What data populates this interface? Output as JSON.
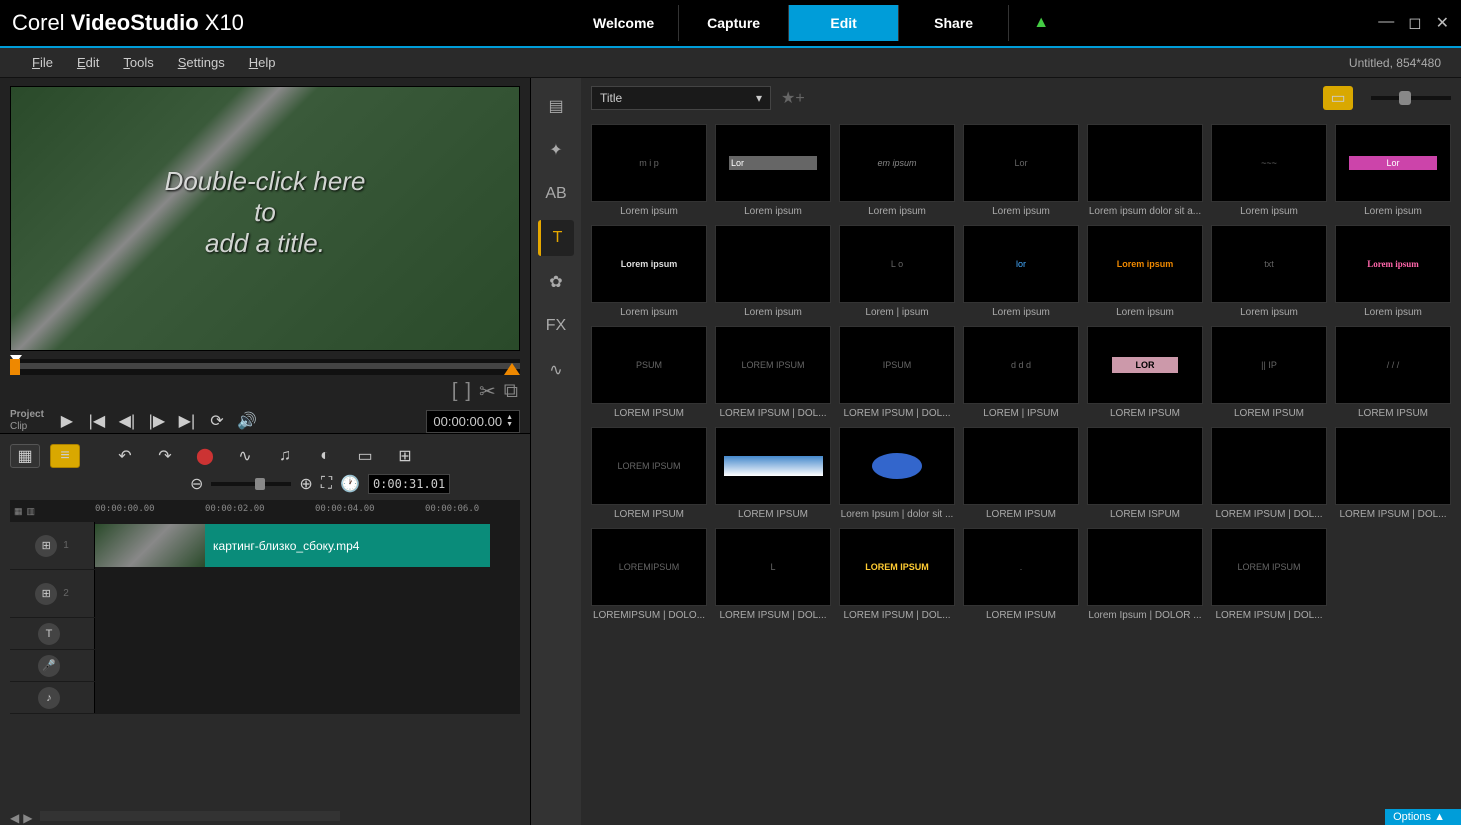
{
  "app": {
    "name_prefix": "Corel",
    "name_main": "VideoStudio",
    "name_suffix": "X10"
  },
  "main_tabs": [
    "Welcome",
    "Capture",
    "Edit",
    "Share"
  ],
  "active_tab": "Edit",
  "menu": [
    "File",
    "Edit",
    "Tools",
    "Settings",
    "Help"
  ],
  "project_info": "Untitled, 854*480",
  "preview": {
    "overlay_line1": "Double-click here",
    "overlay_line2": "to",
    "overlay_line3": "add a title.",
    "mode_a": "Project",
    "mode_b": "Clip",
    "timecode": "00:00:00.00"
  },
  "timeline": {
    "duration": "0:00:31.01",
    "ruler": [
      "00:00:00.00",
      "00:00:02.00",
      "00:00:04.00",
      "00:00:06.0"
    ],
    "clip_name": "картинг-близко_сбоку.mp4",
    "tracks": [
      {
        "id": "video",
        "icon": "film",
        "small": false
      },
      {
        "id": "overlay",
        "icon": "film",
        "small": false
      },
      {
        "id": "title",
        "icon": "T",
        "small": true
      },
      {
        "id": "voice",
        "icon": "mic",
        "small": true
      },
      {
        "id": "music",
        "icon": "note",
        "small": true
      }
    ]
  },
  "library": {
    "dropdown_label": "Title",
    "tabs": [
      {
        "id": "media",
        "glyph": "▤"
      },
      {
        "id": "instant",
        "glyph": "✦"
      },
      {
        "id": "transition",
        "glyph": "AB"
      },
      {
        "id": "title",
        "glyph": "T",
        "active": true
      },
      {
        "id": "graphic",
        "glyph": "✿"
      },
      {
        "id": "filter",
        "glyph": "FX"
      },
      {
        "id": "path",
        "glyph": "∿"
      }
    ],
    "thumbs": [
      {
        "label": "Lorem ipsum",
        "inner": "m  i  p"
      },
      {
        "label": "Lorem ipsum",
        "inner": "Lor",
        "bar": true
      },
      {
        "label": "Lorem ipsum",
        "inner": "em ipsum",
        "ital": true
      },
      {
        "label": "Lorem ipsum",
        "inner": "Lor"
      },
      {
        "label": "Lorem ipsum dolor sit a...",
        "inner": ""
      },
      {
        "label": "Lorem ipsum",
        "inner": "~~~"
      },
      {
        "label": "Lorem ipsum",
        "inner": "Lor",
        "pink": true
      },
      {
        "label": "Lorem ipsum",
        "inner": "Lorem ipsum",
        "bold": true
      },
      {
        "label": "Lorem ipsum",
        "inner": ""
      },
      {
        "label": "Lorem | ipsum",
        "inner": "L  o"
      },
      {
        "label": "Lorem ipsum",
        "inner": "lor",
        "blue": true
      },
      {
        "label": "Lorem ipsum",
        "inner": "Lorem ipsum",
        "orange": true
      },
      {
        "label": "Lorem ipsum",
        "inner": "txt"
      },
      {
        "label": "Lorem ipsum",
        "inner": "Lorem ipsum",
        "rainbow": true
      },
      {
        "label": "LOREM IPSUM",
        "inner": "PSUM"
      },
      {
        "label": "LOREM IPSUM | DOL...",
        "inner": "LOREM IPSUM"
      },
      {
        "label": "LOREM IPSUM | DOL...",
        "inner": "IPSUM"
      },
      {
        "label": "LOREM | IPSUM",
        "inner": "d  d  d"
      },
      {
        "label": "LOREM IPSUM",
        "inner": "LOR",
        "tan": true
      },
      {
        "label": "LOREM IPSUM",
        "inner": "|| IP"
      },
      {
        "label": "LOREM IPSUM",
        "inner": "/ / /"
      },
      {
        "label": "LOREM IPSUM",
        "inner": "LOREM IPSUM"
      },
      {
        "label": "LOREM IPSUM",
        "inner": "▬▬▬",
        "skyimg": true
      },
      {
        "label": "Lorem Ipsum |  dolor sit ...",
        "inner": "●",
        "oval": true
      },
      {
        "label": "LOREM IPSUM",
        "inner": ""
      },
      {
        "label": "LOREM ISPUM",
        "inner": ""
      },
      {
        "label": "LOREM IPSUM | DOL...",
        "inner": ""
      },
      {
        "label": "LOREM IPSUM | DOL...",
        "inner": ""
      },
      {
        "label": "LOREMIPSUM | DOLO...",
        "inner": "LOREMIPSUM"
      },
      {
        "label": "LOREM IPSUM | DOL...",
        "inner": "L"
      },
      {
        "label": "LOREM IPSUM | DOL...",
        "inner": "LOREM IPSUM",
        "gold": true
      },
      {
        "label": "LOREM IPSUM",
        "inner": "."
      },
      {
        "label": "Lorem Ipsum | DOLOR ...",
        "inner": ""
      },
      {
        "label": "LOREM IPSUM | DOL...",
        "inner": "LOREM IPSUM"
      }
    ]
  },
  "options_label": "Options"
}
